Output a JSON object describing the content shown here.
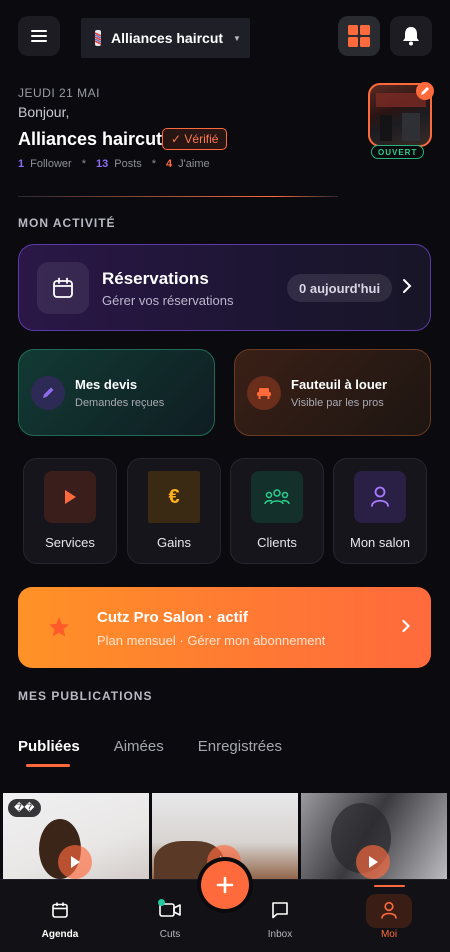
{
  "header": {
    "salon_name": "Alliances haircut",
    "salon_icon": "barber-pole-icon",
    "menu_icon": "hamburger-icon",
    "grid_icon": "grid-icon",
    "bell_icon": "bell-icon"
  },
  "profile": {
    "date": "JEUDI 21 MAI",
    "greeting": "Bonjour,",
    "name": "Alliances haircut",
    "verified_label": "✓ Vérifié",
    "followers_count": "1",
    "followers_label": "Follower",
    "posts_count": "13",
    "posts_label": "Posts",
    "likes_count": "4",
    "likes_label": "J'aime",
    "separator": "*",
    "status": "OUVERT"
  },
  "activity": {
    "section_title": "MON ACTIVITÉ",
    "reservations": {
      "title": "Réservations",
      "subtitle": "Gérer vos réservations",
      "badge": "0 aujourd'hui"
    },
    "devis": {
      "title": "Mes devis",
      "subtitle": "Demandes reçues"
    },
    "fauteuil": {
      "title": "Fauteuil à louer",
      "subtitle": "Visible par les pros"
    },
    "tiles": [
      {
        "label": "Services",
        "icon": "play-icon"
      },
      {
        "label": "Gains",
        "icon": "euro-icon"
      },
      {
        "label": "Clients",
        "icon": "users-icon"
      },
      {
        "label": "Mon salon",
        "icon": "user-icon"
      }
    ]
  },
  "pro": {
    "title": "Cutz Pro Salon · actif",
    "subtitle": "Plan mensuel · Gérer mon abonnement"
  },
  "publications": {
    "section_title": "MES PUBLICATIONS",
    "tabs": [
      "Publiées",
      "Aimées",
      "Enregistrées"
    ],
    "active_tab": "Publiées",
    "pin_badge": "�� "
  },
  "bottom_nav": {
    "items": [
      {
        "label": "Agenda",
        "icon": "calendar-icon"
      },
      {
        "label": "Cuts",
        "icon": "video-icon"
      },
      {
        "label": "Inbox",
        "icon": "chat-icon"
      },
      {
        "label": "Moi",
        "icon": "user-icon"
      }
    ],
    "active": "Moi",
    "fab_icon": "plus-icon"
  },
  "colors": {
    "accent": "#ff6a3d",
    "purple": "#8e6cf0",
    "green": "#2bd08e",
    "background": "#0b0b0f"
  }
}
